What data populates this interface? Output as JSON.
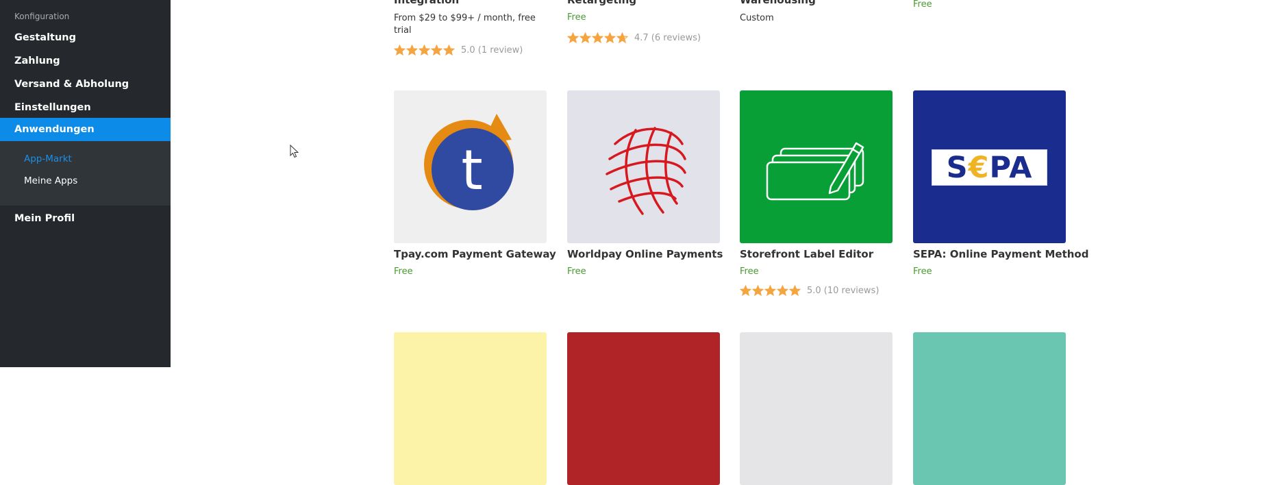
{
  "sidebar": {
    "section_label": "Konfiguration",
    "items": [
      {
        "label": "Gestaltung"
      },
      {
        "label": "Zahlung"
      },
      {
        "label": "Versand & Abholung"
      },
      {
        "label": "Einstellungen"
      },
      {
        "label": "Anwendungen",
        "active": true
      }
    ],
    "subitems": [
      {
        "label": "App-Markt",
        "active": true
      },
      {
        "label": "Meine Apps"
      }
    ],
    "profile_label": "Mein Profil"
  },
  "colors": {
    "sidebar_bg": "#25292d",
    "active_accent": "#0d8be8",
    "price_green": "#4a9a33",
    "star_orange": "#f4a540"
  },
  "top_row": [
    {
      "title": "Integration",
      "price": "From $29 to $99+ / month, free trial",
      "rating_text": "5.0 (1 review)",
      "rating": 5
    },
    {
      "title": "Retargeting",
      "price": "Free",
      "rating_text": "4.7 (6 reviews)",
      "rating": 4.7
    },
    {
      "title": "Warehousing",
      "price": "Custom"
    },
    {
      "price": "Free"
    }
  ],
  "apps": [
    {
      "title": "Tpay.com Payment Gateway",
      "price": "Free",
      "logo": "tpay-logo-icon"
    },
    {
      "title": "Worldpay Online Payments",
      "price": "Free",
      "logo": "worldpay-globe-icon"
    },
    {
      "title": "Storefront Label Editor",
      "price": "Free",
      "rating_text": "5.0 (10 reviews)",
      "rating": 5,
      "logo": "label-editor-icon"
    },
    {
      "title": "SEPA: Online Payment Method",
      "price": "Free",
      "logo": "sepa-logo-icon",
      "logo_text": "S€PA"
    }
  ],
  "bottom_tiles": [
    {
      "color": "#fdf3a8"
    },
    {
      "color": "#b02428"
    },
    {
      "color": "#e5e5e8"
    },
    {
      "color": "#6ac6b1"
    }
  ]
}
